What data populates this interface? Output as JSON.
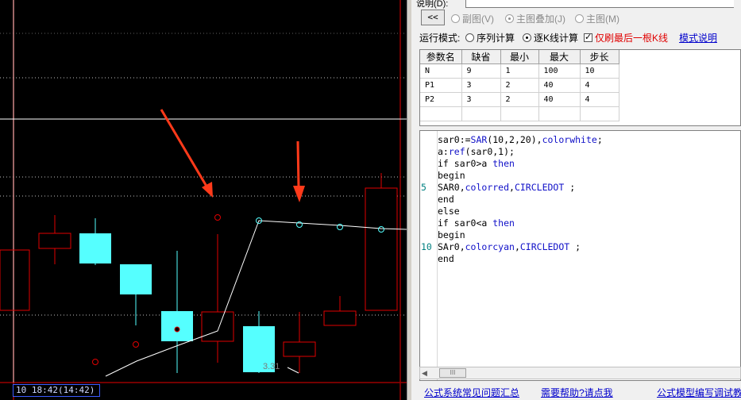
{
  "chart": {
    "status_text": "10 18:42(14:42)",
    "watermark": "3.31"
  },
  "editor": {
    "desc_label": "说明(D):",
    "nav_button": "<<",
    "view_options": [
      {
        "label": "副图(V)",
        "selected": false
      },
      {
        "label": "主图叠加(J)",
        "selected": true
      },
      {
        "label": "主图(M)",
        "selected": false
      }
    ],
    "mode_label": "运行模式:",
    "mode_options": [
      {
        "label": "序列计算",
        "selected": false
      },
      {
        "label": "逐K线计算",
        "selected": true
      }
    ],
    "last_bar_checkbox": {
      "label": "仅刷最后一根K线",
      "checked": true
    },
    "mode_help_link": "模式说明",
    "param_table": {
      "columns": [
        "参数名",
        "缺省",
        "最小",
        "最大",
        "步长"
      ],
      "rows": [
        [
          "N",
          "9",
          "1",
          "100",
          "10"
        ],
        [
          "P1",
          "3",
          "2",
          "40",
          "4"
        ],
        [
          "P2",
          "3",
          "2",
          "40",
          "4"
        ],
        [
          "",
          "",
          "",
          "",
          ""
        ]
      ]
    },
    "code_lines": [
      "sar0:=SAR(10,2,20),colorwhite;",
      "a:ref(sar0,1);",
      "if sar0>a then",
      "begin",
      "SAR0,colorred,CIRCLEDOT ;",
      "end",
      "else",
      "if sar0<a then",
      "begin",
      "SAr0,colorcyan,CIRCLEDOT ;",
      "end"
    ],
    "line_numbers": [
      "5",
      "10"
    ],
    "scroll_thumb": "III",
    "footer_links": [
      "公式系统常见问题汇总",
      "需要帮助?请点我",
      "公式模型编写调试教"
    ]
  },
  "colors": {
    "cyan": "#55ffff",
    "red": "#e00000",
    "white": "#ffffff",
    "editor_bg": "#f0f0f0",
    "link": "#0000cc"
  }
}
